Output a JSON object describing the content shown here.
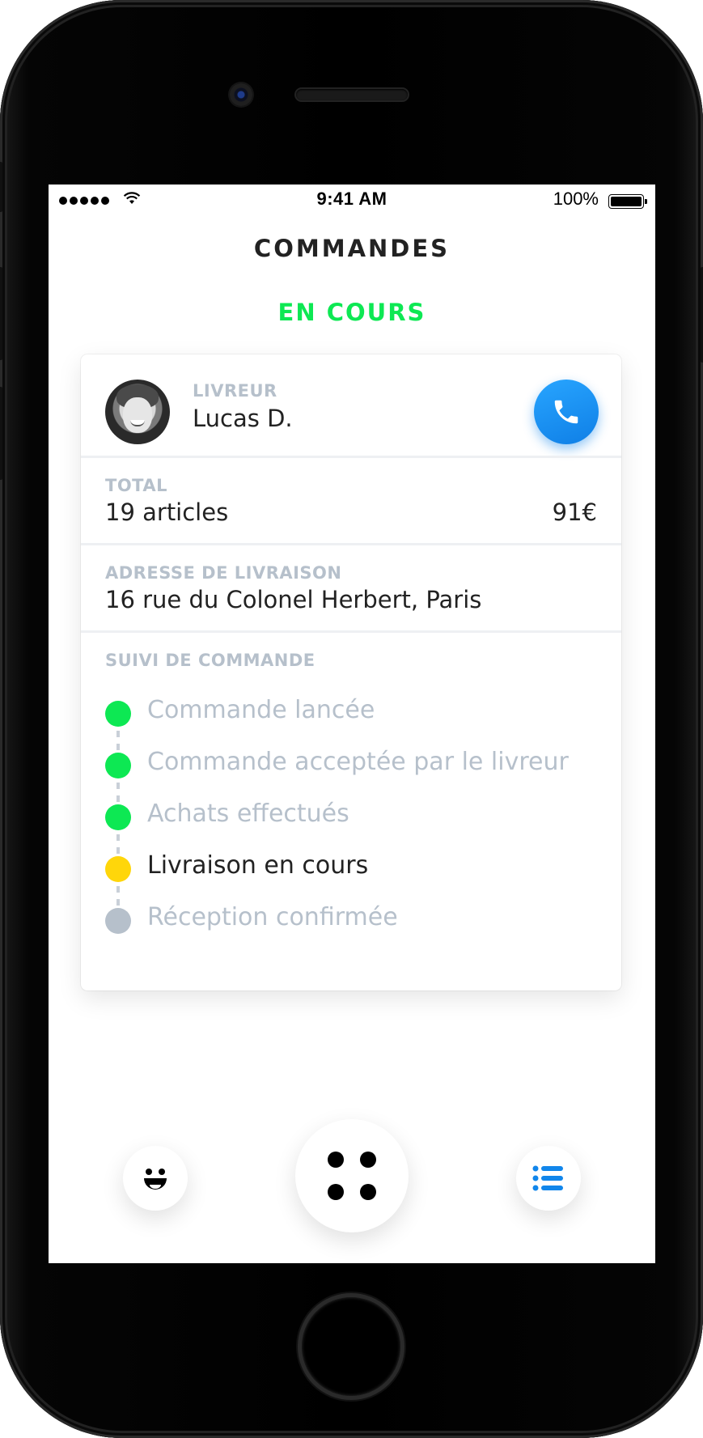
{
  "status_bar": {
    "time": "9:41 AM",
    "battery": "100%"
  },
  "header": {
    "title": "COMMANDES"
  },
  "section": {
    "title": "EN COURS"
  },
  "courier": {
    "label": "LIVREUR",
    "name": "Lucas D."
  },
  "total": {
    "label": "TOTAL",
    "items": "19 articles",
    "price": "91€"
  },
  "address": {
    "label": "ADRESSE DE LIVRAISON",
    "value": "16 rue du Colonel Herbert, Paris"
  },
  "tracking": {
    "label": "SUIVI DE COMMANDE",
    "steps": [
      {
        "text": "Commande lancée",
        "status": "done"
      },
      {
        "text": "Commande acceptée par le livreur",
        "status": "done"
      },
      {
        "text": "Achats effectués",
        "status": "done"
      },
      {
        "text": "Livraison en cours",
        "status": "current"
      },
      {
        "text": "Réception confirmée",
        "status": "pending"
      }
    ]
  },
  "colors": {
    "accent_green": "#0de853",
    "accent_blue": "#1186eb",
    "pending_yellow": "#ffd60a",
    "muted": "#b6c0cb"
  },
  "icons": [
    "wifi-icon",
    "battery-icon",
    "phone-icon",
    "smiley-icon",
    "grid-icon",
    "list-icon"
  ]
}
